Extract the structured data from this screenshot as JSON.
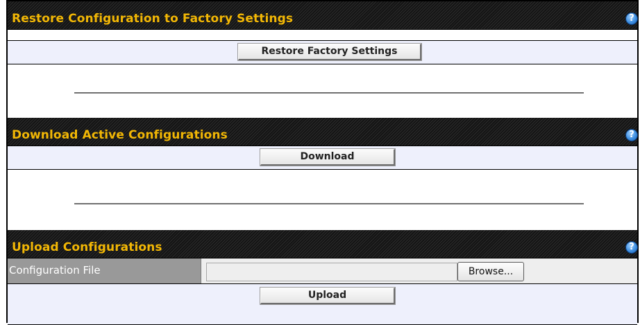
{
  "sections": {
    "restore": {
      "title": "Restore Configuration to Factory Settings",
      "button_label": "Restore Factory Settings"
    },
    "download": {
      "title": "Download Active Configurations",
      "button_label": "Download"
    },
    "upload": {
      "title": "Upload Configurations",
      "file_label": "Configuration File",
      "file_value": "",
      "browse_label": "Browse...",
      "button_label": "Upload"
    }
  },
  "help_icon_glyph": "?",
  "colors": {
    "header_text": "#f2b705",
    "row_bg": "#eef0fc",
    "label_bg": "#999999"
  }
}
